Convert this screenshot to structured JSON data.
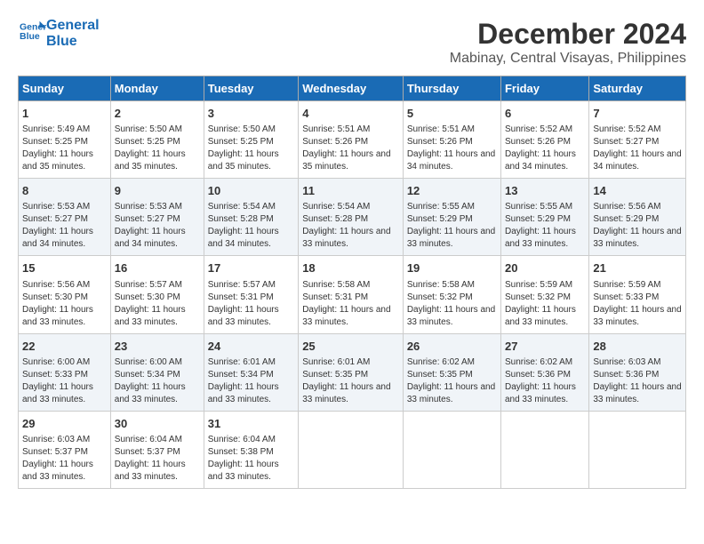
{
  "logo": {
    "line1": "General",
    "line2": "Blue"
  },
  "title": "December 2024",
  "subtitle": "Mabinay, Central Visayas, Philippines",
  "days_of_week": [
    "Sunday",
    "Monday",
    "Tuesday",
    "Wednesday",
    "Thursday",
    "Friday",
    "Saturday"
  ],
  "weeks": [
    [
      {
        "day": "1",
        "sunrise": "5:49 AM",
        "sunset": "5:25 PM",
        "daylight": "11 hours and 35 minutes."
      },
      {
        "day": "2",
        "sunrise": "5:50 AM",
        "sunset": "5:25 PM",
        "daylight": "11 hours and 35 minutes."
      },
      {
        "day": "3",
        "sunrise": "5:50 AM",
        "sunset": "5:25 PM",
        "daylight": "11 hours and 35 minutes."
      },
      {
        "day": "4",
        "sunrise": "5:51 AM",
        "sunset": "5:26 PM",
        "daylight": "11 hours and 35 minutes."
      },
      {
        "day": "5",
        "sunrise": "5:51 AM",
        "sunset": "5:26 PM",
        "daylight": "11 hours and 34 minutes."
      },
      {
        "day": "6",
        "sunrise": "5:52 AM",
        "sunset": "5:26 PM",
        "daylight": "11 hours and 34 minutes."
      },
      {
        "day": "7",
        "sunrise": "5:52 AM",
        "sunset": "5:27 PM",
        "daylight": "11 hours and 34 minutes."
      }
    ],
    [
      {
        "day": "8",
        "sunrise": "5:53 AM",
        "sunset": "5:27 PM",
        "daylight": "11 hours and 34 minutes."
      },
      {
        "day": "9",
        "sunrise": "5:53 AM",
        "sunset": "5:27 PM",
        "daylight": "11 hours and 34 minutes."
      },
      {
        "day": "10",
        "sunrise": "5:54 AM",
        "sunset": "5:28 PM",
        "daylight": "11 hours and 34 minutes."
      },
      {
        "day": "11",
        "sunrise": "5:54 AM",
        "sunset": "5:28 PM",
        "daylight": "11 hours and 33 minutes."
      },
      {
        "day": "12",
        "sunrise": "5:55 AM",
        "sunset": "5:29 PM",
        "daylight": "11 hours and 33 minutes."
      },
      {
        "day": "13",
        "sunrise": "5:55 AM",
        "sunset": "5:29 PM",
        "daylight": "11 hours and 33 minutes."
      },
      {
        "day": "14",
        "sunrise": "5:56 AM",
        "sunset": "5:29 PM",
        "daylight": "11 hours and 33 minutes."
      }
    ],
    [
      {
        "day": "15",
        "sunrise": "5:56 AM",
        "sunset": "5:30 PM",
        "daylight": "11 hours and 33 minutes."
      },
      {
        "day": "16",
        "sunrise": "5:57 AM",
        "sunset": "5:30 PM",
        "daylight": "11 hours and 33 minutes."
      },
      {
        "day": "17",
        "sunrise": "5:57 AM",
        "sunset": "5:31 PM",
        "daylight": "11 hours and 33 minutes."
      },
      {
        "day": "18",
        "sunrise": "5:58 AM",
        "sunset": "5:31 PM",
        "daylight": "11 hours and 33 minutes."
      },
      {
        "day": "19",
        "sunrise": "5:58 AM",
        "sunset": "5:32 PM",
        "daylight": "11 hours and 33 minutes."
      },
      {
        "day": "20",
        "sunrise": "5:59 AM",
        "sunset": "5:32 PM",
        "daylight": "11 hours and 33 minutes."
      },
      {
        "day": "21",
        "sunrise": "5:59 AM",
        "sunset": "5:33 PM",
        "daylight": "11 hours and 33 minutes."
      }
    ],
    [
      {
        "day": "22",
        "sunrise": "6:00 AM",
        "sunset": "5:33 PM",
        "daylight": "11 hours and 33 minutes."
      },
      {
        "day": "23",
        "sunrise": "6:00 AM",
        "sunset": "5:34 PM",
        "daylight": "11 hours and 33 minutes."
      },
      {
        "day": "24",
        "sunrise": "6:01 AM",
        "sunset": "5:34 PM",
        "daylight": "11 hours and 33 minutes."
      },
      {
        "day": "25",
        "sunrise": "6:01 AM",
        "sunset": "5:35 PM",
        "daylight": "11 hours and 33 minutes."
      },
      {
        "day": "26",
        "sunrise": "6:02 AM",
        "sunset": "5:35 PM",
        "daylight": "11 hours and 33 minutes."
      },
      {
        "day": "27",
        "sunrise": "6:02 AM",
        "sunset": "5:36 PM",
        "daylight": "11 hours and 33 minutes."
      },
      {
        "day": "28",
        "sunrise": "6:03 AM",
        "sunset": "5:36 PM",
        "daylight": "11 hours and 33 minutes."
      }
    ],
    [
      {
        "day": "29",
        "sunrise": "6:03 AM",
        "sunset": "5:37 PM",
        "daylight": "11 hours and 33 minutes."
      },
      {
        "day": "30",
        "sunrise": "6:04 AM",
        "sunset": "5:37 PM",
        "daylight": "11 hours and 33 minutes."
      },
      {
        "day": "31",
        "sunrise": "6:04 AM",
        "sunset": "5:38 PM",
        "daylight": "11 hours and 33 minutes."
      },
      null,
      null,
      null,
      null
    ]
  ]
}
